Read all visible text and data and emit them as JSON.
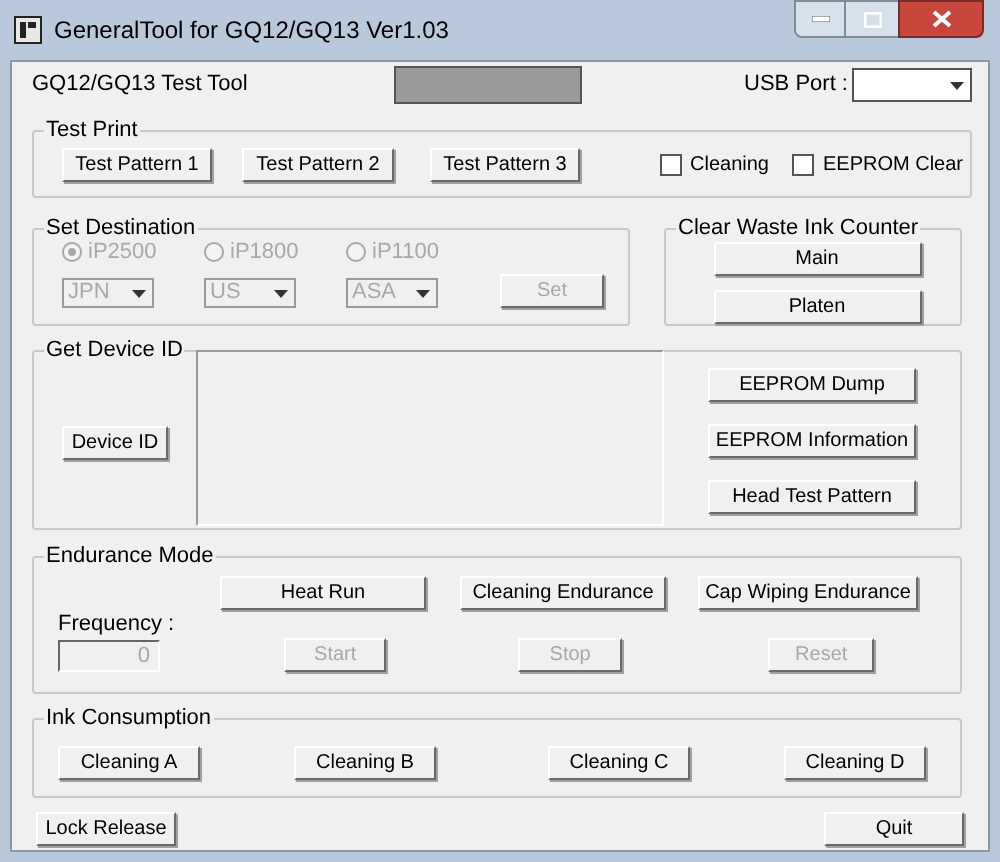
{
  "window": {
    "title": "GeneralTool for GQ12/GQ13 Ver1.03"
  },
  "header": {
    "title": "GQ12/GQ13 Test Tool",
    "usb_port_label": "USB Port :"
  },
  "test_print": {
    "title": "Test Print",
    "buttons": [
      "Test Pattern 1",
      "Test Pattern 2",
      "Test Pattern 3"
    ],
    "checkboxes": [
      {
        "label": "Cleaning",
        "checked": false
      },
      {
        "label": "EEPROM Clear",
        "checked": false
      }
    ]
  },
  "set_destination": {
    "title": "Set Destination",
    "models": [
      {
        "label": "iP2500",
        "selected": true,
        "disabled": true
      },
      {
        "label": "iP1800",
        "selected": false,
        "disabled": true
      },
      {
        "label": "iP1100",
        "selected": false,
        "disabled": true
      }
    ],
    "regions": [
      {
        "value": "JPN",
        "disabled": true
      },
      {
        "value": "US",
        "disabled": true
      },
      {
        "value": "ASA",
        "disabled": true
      }
    ],
    "set_button": {
      "label": "Set",
      "disabled": true
    }
  },
  "clear_waste_ink_counter": {
    "title": "Clear Waste Ink Counter",
    "buttons": [
      "Main",
      "Platen"
    ]
  },
  "get_device_id": {
    "title": "Get Device ID",
    "device_id_button": "Device ID",
    "buttons": [
      "EEPROM Dump",
      "EEPROM Information",
      "Head Test Pattern"
    ]
  },
  "endurance_mode": {
    "title": "Endurance Mode",
    "tests": [
      "Heat Run",
      "Cleaning Endurance",
      "Cap Wiping Endurance"
    ],
    "frequency": {
      "label": "Frequency :",
      "value": "0",
      "disabled": true
    },
    "controls": [
      {
        "label": "Start",
        "disabled": true
      },
      {
        "label": "Stop",
        "disabled": true
      },
      {
        "label": "Reset",
        "disabled": true
      }
    ]
  },
  "ink_consumption": {
    "title": "Ink Consumption",
    "buttons": [
      "Cleaning A",
      "Cleaning B",
      "Cleaning C",
      "Cleaning D"
    ]
  },
  "footer": {
    "lock_release": "Lock Release",
    "quit": "Quit"
  }
}
